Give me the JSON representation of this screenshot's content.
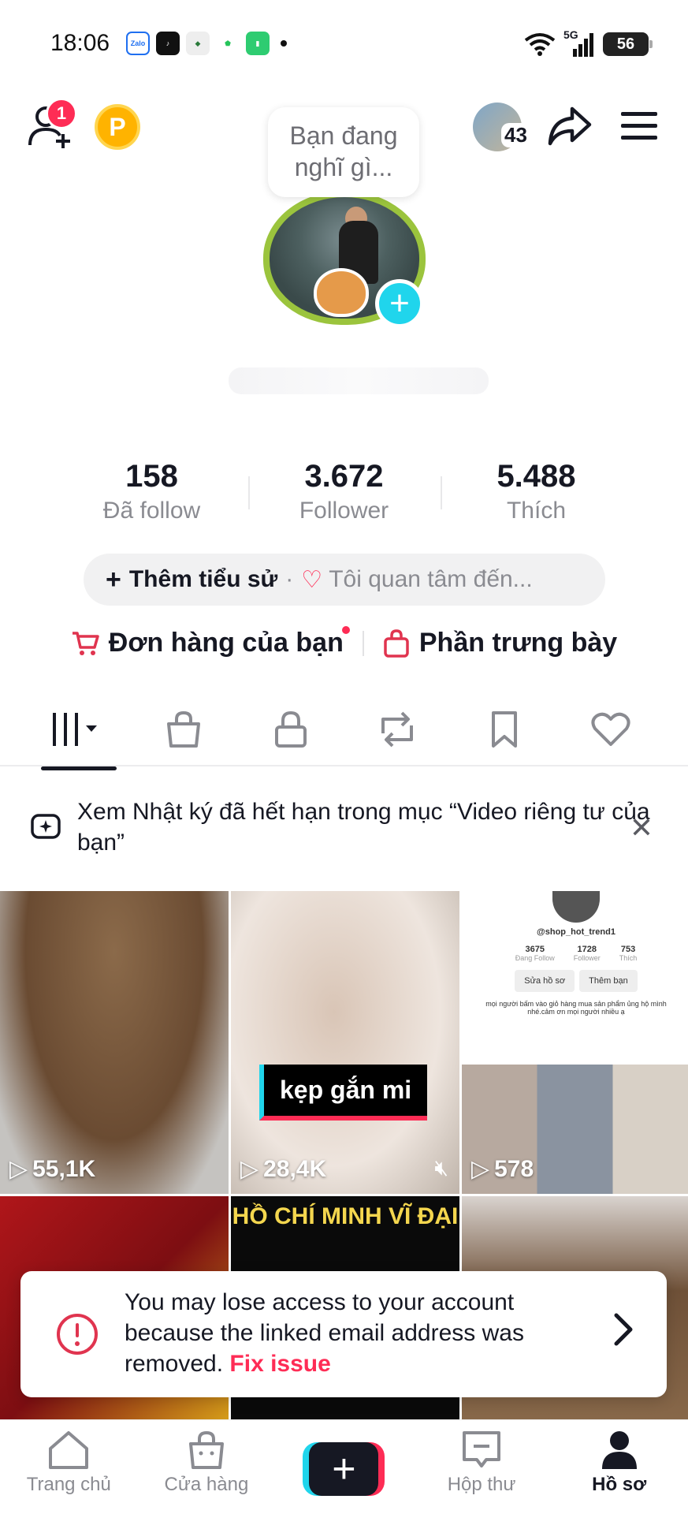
{
  "status_bar": {
    "time": "18:06",
    "apps": [
      "Zalo",
      "TikTok",
      "Shield",
      "Shield2",
      "Battery"
    ],
    "network": "5G",
    "battery": "56"
  },
  "header": {
    "friend_badge": "1",
    "coin_label": "P",
    "friends_count": "43"
  },
  "profile": {
    "thought_bubble": "Bạn đang nghĩ gì...",
    "stats": [
      {
        "value": "158",
        "label": "Đã follow"
      },
      {
        "value": "3.672",
        "label": "Follower"
      },
      {
        "value": "5.488",
        "label": "Thích"
      }
    ],
    "bio_add": "Thêm tiểu sử",
    "bio_interest": "Tôi quan tâm đến...",
    "orders": "Đơn hàng của bạn",
    "showcase": "Phần trưng bày"
  },
  "notice": {
    "text": "Xem Nhật ký đã hết hạn trong mục “Video riêng tư của bạn”"
  },
  "grid": {
    "items": [
      {
        "views": "55,1K"
      },
      {
        "views": "28,4K",
        "caption": "kẹp gắn mi"
      },
      {
        "views": "578"
      },
      {
        "caption": ""
      },
      {
        "caption": "HỒ CHÍ MINH VĨ ĐẠI"
      },
      {
        "caption": ""
      }
    ],
    "mini_profile": {
      "handle": "@shop_hot_trend1",
      "following": "3675",
      "following_label": "Đang Follow",
      "followers": "1728",
      "followers_label": "Follower",
      "likes": "753",
      "likes_label": "Thích",
      "btn_edit": "Sửa hồ sơ",
      "btn_add": "Thêm bạn",
      "desc": "mọi người bấm vào giỏ hàng mua sản phẩm ủng hộ mình nhé.cảm ơn mọi người nhiều ạ"
    }
  },
  "warning": {
    "text": "You may lose access to your account because the linked email address was removed.",
    "fix": "Fix issue"
  },
  "nav": {
    "home": "Trang chủ",
    "shop": "Cửa hàng",
    "inbox": "Hộp thư",
    "profile": "Hồ sơ"
  },
  "colors": {
    "accent_red": "#fe2c55",
    "accent_cyan": "#20d5ec",
    "text": "#161823",
    "muted": "#8a8b91"
  }
}
